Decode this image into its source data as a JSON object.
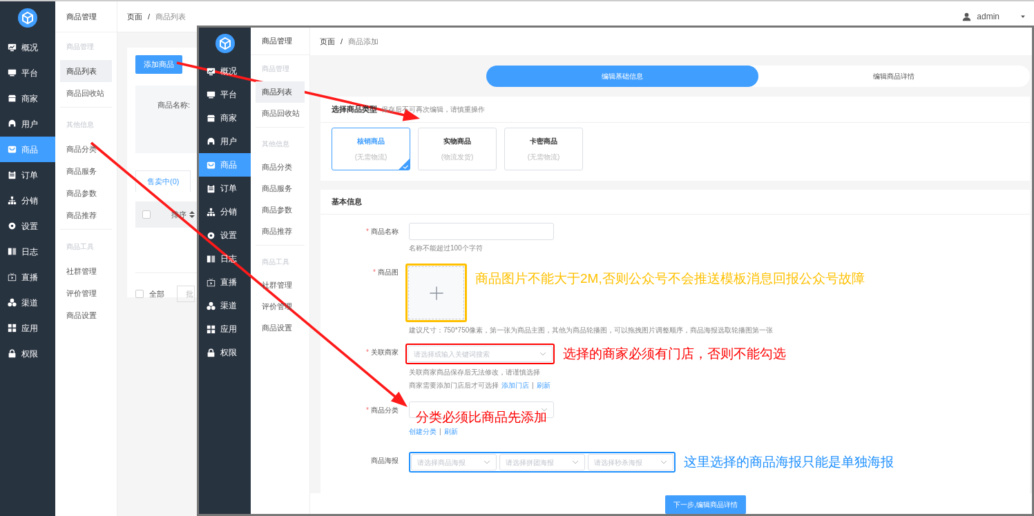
{
  "back_app": {
    "nav": [
      {
        "label": "概况",
        "selected": false
      },
      {
        "label": "平台",
        "selected": false
      },
      {
        "label": "商家",
        "selected": false
      },
      {
        "label": "用户",
        "selected": false
      },
      {
        "label": "商品",
        "selected": true
      },
      {
        "label": "订单",
        "selected": false
      },
      {
        "label": "分销",
        "selected": false
      },
      {
        "label": "设置",
        "selected": false
      },
      {
        "label": "日志",
        "selected": false
      },
      {
        "label": "直播",
        "selected": false
      },
      {
        "label": "渠道",
        "selected": false
      },
      {
        "label": "应用",
        "selected": false
      },
      {
        "label": "权限",
        "selected": false
      }
    ],
    "submenu": {
      "title": "商品管理",
      "groups": [
        {
          "heading": "商品管理",
          "items": [
            {
              "label": "商品列表",
              "selected": true
            },
            {
              "label": "商品回收站",
              "selected": false
            }
          ]
        },
        {
          "heading": "其他信息",
          "items": [
            {
              "label": "商品分类",
              "selected": false
            },
            {
              "label": "商品服务",
              "selected": false
            },
            {
              "label": "商品参数",
              "selected": false
            },
            {
              "label": "商品推荐",
              "selected": false
            }
          ]
        },
        {
          "heading": "商品工具",
          "items": [
            {
              "label": "社群管理",
              "selected": false
            },
            {
              "label": "评价管理",
              "selected": false
            },
            {
              "label": "商品设置",
              "selected": false
            }
          ]
        }
      ]
    },
    "breadcrumb": {
      "items": [
        "页面",
        "商品列表"
      ],
      "separator": "/"
    },
    "user": "admin",
    "add_button": "添加商品",
    "filter_label": "商品名称:",
    "tabs": [
      {
        "label": "售卖中(0)",
        "selected": true
      }
    ],
    "columns": [
      {
        "label": "排序",
        "checked": false
      }
    ],
    "select_all": {
      "label": "全部",
      "checked": false
    },
    "batch_placeholder": "批"
  },
  "front_app": {
    "nav": [
      {
        "label": "概况",
        "selected": false
      },
      {
        "label": "平台",
        "selected": false
      },
      {
        "label": "商家",
        "selected": false
      },
      {
        "label": "用户",
        "selected": false
      },
      {
        "label": "商品",
        "selected": true
      },
      {
        "label": "订单",
        "selected": false
      },
      {
        "label": "分销",
        "selected": false
      },
      {
        "label": "设置",
        "selected": false
      },
      {
        "label": "日志",
        "selected": false
      },
      {
        "label": "直播",
        "selected": false
      },
      {
        "label": "渠道",
        "selected": false
      },
      {
        "label": "应用",
        "selected": false
      },
      {
        "label": "权限",
        "selected": false
      }
    ],
    "submenu": {
      "title": "商品管理",
      "groups": [
        {
          "heading": "商品管理",
          "items": [
            {
              "label": "商品列表",
              "selected": true
            },
            {
              "label": "商品回收站",
              "selected": false
            }
          ]
        },
        {
          "heading": "其他信息",
          "items": [
            {
              "label": "商品分类",
              "selected": false
            },
            {
              "label": "商品服务",
              "selected": false
            },
            {
              "label": "商品参数",
              "selected": false
            },
            {
              "label": "商品推荐",
              "selected": false
            }
          ]
        },
        {
          "heading": "商品工具",
          "items": [
            {
              "label": "社群管理",
              "selected": false
            },
            {
              "label": "评价管理",
              "selected": false
            },
            {
              "label": "商品设置",
              "selected": false
            }
          ]
        }
      ]
    },
    "breadcrumb": {
      "items": [
        "页面",
        "商品添加"
      ],
      "separator": "/"
    },
    "steps": [
      {
        "label": "编辑基础信息",
        "selected": true
      },
      {
        "label": "编辑商品详情",
        "selected": false
      }
    ],
    "type_section": {
      "title": "选择商品类型",
      "note": "保存后不可再次编辑，请慎重操作"
    },
    "types": [
      {
        "name": "核销商品",
        "note": "(无需物流)",
        "selected": true
      },
      {
        "name": "实物商品",
        "note": "(物流发货)",
        "selected": false
      },
      {
        "name": "卡密商品",
        "note": "(无需物流)",
        "selected": false
      }
    ],
    "basic_title": "基本信息",
    "fields": [
      {
        "kind": "input",
        "label": "商品名称",
        "marker": "*",
        "hints": [
          {
            "text": "名称不能超过100个字符"
          }
        ]
      },
      {
        "kind": "upload",
        "label": "商品图",
        "marker": "*",
        "annotation": {
          "text": "商品图片不能大于2M,否则公众号不会推送模板消息回报公众号故障",
          "color": "#ffc000",
          "boxed": true
        },
        "hints": [
          {
            "text": "建议尺寸：750*750像素，第一张为商品主图，其他为商品轮播图，可以拖拽图片调整顺序，商品海报选取轮播图第一张"
          }
        ]
      },
      {
        "kind": "select",
        "label": "关联商家",
        "marker": "*",
        "placeholders": [
          "请选择或输入关键词搜索"
        ],
        "annotation": {
          "text": "选择的商家必须有门店，否则不能勾选",
          "color": "#ff0000",
          "boxed": true
        },
        "hints": [
          {
            "text": "关联商家商品保存后无法修改，请谨慎选择"
          },
          {
            "text": "商家需要添加门店后才可选择",
            "links": [
              "添加门店",
              "刷新"
            ],
            "separator": "|"
          }
        ]
      },
      {
        "kind": "select",
        "label": "商品分类",
        "marker": "*",
        "annotation": {
          "text": "分类必须比商品先添加",
          "color": "#ff0000",
          "boxed": false
        },
        "hints": [
          {
            "links": [
              "创建分类",
              "刷新"
            ],
            "separator": "|"
          }
        ]
      },
      {
        "kind": "select",
        "label": "商品海报",
        "placeholders": [
          "请选择商品海报",
          "请选择拼团海报",
          "请选择秒杀海报"
        ],
        "annotation": {
          "text": "这里选择的商品海报只能是单独海报",
          "color": "#1e90ff",
          "boxed": true
        }
      }
    ],
    "next_button": "下一步,编辑商品详情"
  }
}
